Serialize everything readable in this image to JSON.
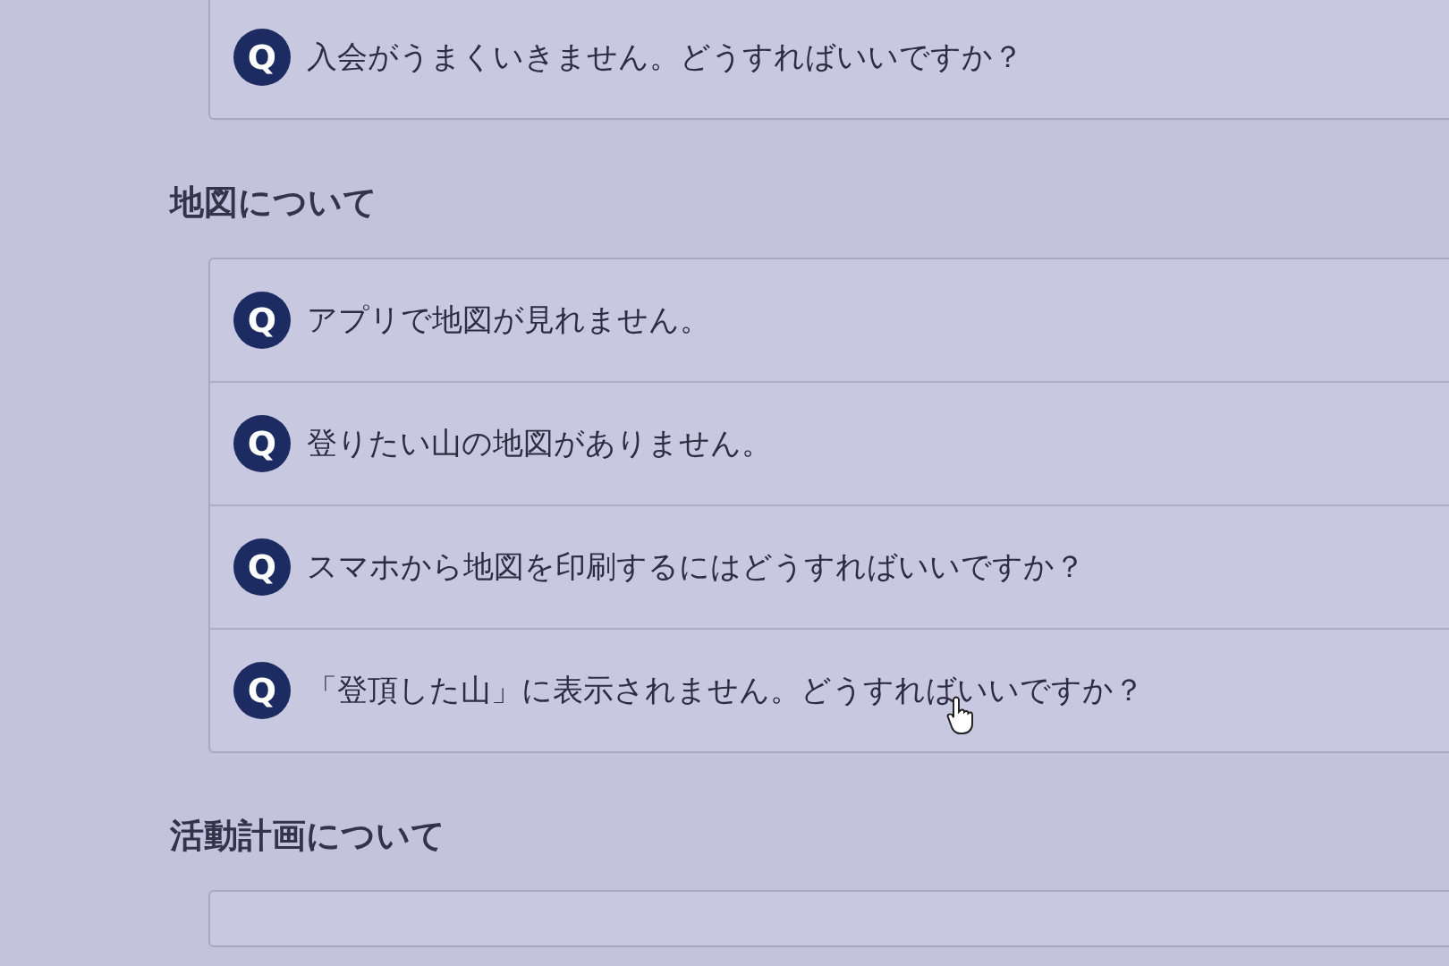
{
  "sections": [
    {
      "questions": [
        {
          "badge": "Q",
          "text": "入会がうまくいきません。どうすればいいですか？"
        }
      ]
    },
    {
      "heading": "地図について",
      "questions": [
        {
          "badge": "Q",
          "text": "アプリで地図が見れません。"
        },
        {
          "badge": "Q",
          "text": "登りたい山の地図がありません。"
        },
        {
          "badge": "Q",
          "text": "スマホから地図を印刷するにはどうすればいいですか？"
        },
        {
          "badge": "Q",
          "text": "「登頂した山」に表示されません。どうすればいいですか？",
          "hovered": true
        }
      ]
    },
    {
      "heading": "活動計画について"
    }
  ]
}
